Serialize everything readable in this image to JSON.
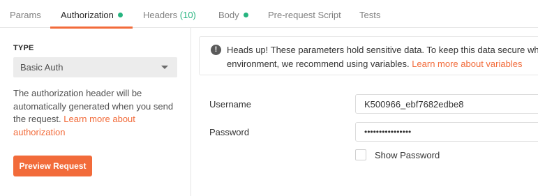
{
  "tabs": [
    {
      "label": "Params",
      "active": false
    },
    {
      "label": "Authorization",
      "active": true,
      "has_dot": true
    },
    {
      "label": "Headers",
      "count": "(10)",
      "active": false
    },
    {
      "label": "Body",
      "active": false,
      "has_dot": true
    },
    {
      "label": "Pre-request Script",
      "active": false
    },
    {
      "label": "Tests",
      "active": false
    }
  ],
  "auth": {
    "type_label": "TYPE",
    "type_value": "Basic Auth",
    "description": "The authorization header will be automatically generated when you send the request. ",
    "learn_more": "Learn more about authorization",
    "preview_button": "Preview Request"
  },
  "alert": {
    "icon": "exclamation-icon",
    "text_line1": "Heads up! These parameters hold sensitive data. To keep this data secure while",
    "text_line2": "environment, we recommend using variables. ",
    "link": "Learn more about variables"
  },
  "fields": {
    "username_label": "Username",
    "username_value": "K500966_ebf7682edbe8",
    "password_label": "Password",
    "password_value": "••••••••••••••••",
    "show_password_label": "Show Password",
    "show_password_checked": false
  },
  "colors": {
    "accent": "#f26b3a",
    "success": "#26b47f"
  }
}
